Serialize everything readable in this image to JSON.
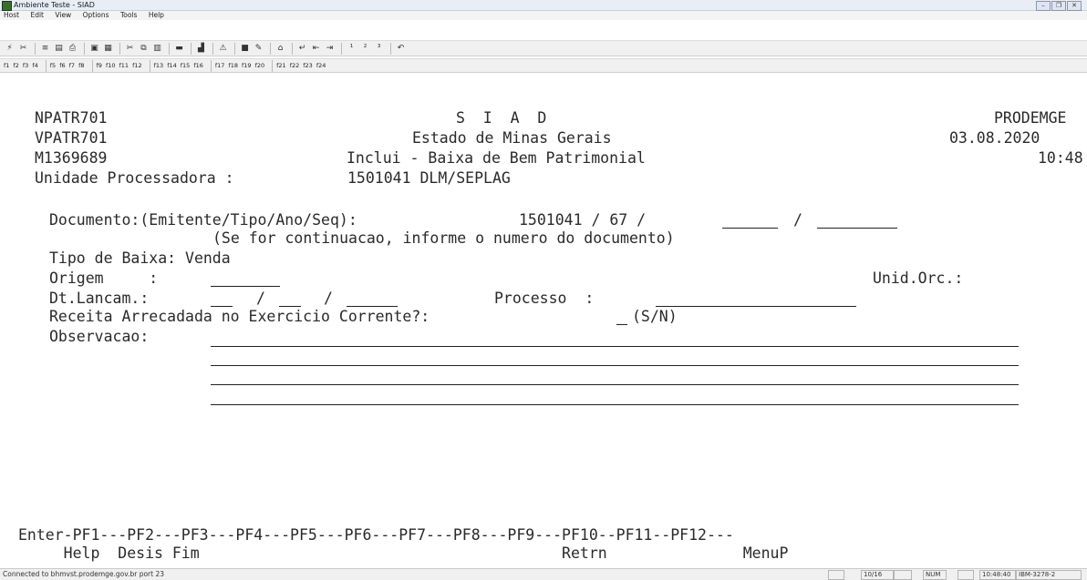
{
  "window": {
    "title": "Ambiente Teste - SIAD",
    "controls": [
      "–",
      "❐",
      "✕"
    ]
  },
  "menu": [
    "Host",
    "Edit",
    "View",
    "Options",
    "Tools",
    "Help"
  ],
  "fkeys": [
    "f1",
    "f2",
    "f3",
    "f4",
    "f5",
    "f6",
    "f7",
    "f8",
    "f9",
    "f10",
    "f11",
    "f12",
    "f13",
    "f14",
    "f15",
    "f16",
    "f17",
    "f18",
    "f19",
    "f20",
    "f21",
    "f22",
    "f23",
    "f24"
  ],
  "screen": {
    "program": "NPATR701",
    "system": "S  I  A  D",
    "company": "PRODEMGE",
    "view": "VPATR701",
    "state": "Estado de Minas Gerais",
    "date": "03.08.2020",
    "user": "M1369689",
    "operation": "Inclui - Baixa de Bem Patrimonial",
    "time": "10:48",
    "unit_label": "Unidade Processadora :",
    "unit_value": "1501041 DLM/SEPLAG",
    "doc_label": "Documento:(Emitente/Tipo/Ano/Seq):",
    "doc_value": "1501041 / 67 /",
    "doc_sep": "/",
    "doc_hint": "(Se for continuacao, informe o numero do documento)",
    "baixa_type": "Tipo de Baixa: Venda",
    "origem_label": "Origem     :",
    "unid_orc_label": "Unid.Orc.:",
    "dt_label": "Dt.Lancam.:",
    "dt_sep1": "/",
    "dt_sep2": "/",
    "processo_label": "Processo  :",
    "receita_label": "Receita Arrecadada no Exercicio Corrente?:",
    "receita_hint": "(S/N)",
    "obs_label": "Observacao:",
    "pf_line": "Enter-PF1---PF2---PF3---PF4---PF5---PF6---PF7---PF8---PF9---PF10--PF11--PF12---",
    "pf_labels": "     Help  Desis Fim                                        Retrn               MenuP"
  },
  "status": {
    "connection": "Connected to bhmvst.prodemge.gov.br port 23",
    "cursor": "10/16",
    "num": "NUM",
    "clock": "10:48:40",
    "terminal": "IBM-3278-2"
  }
}
